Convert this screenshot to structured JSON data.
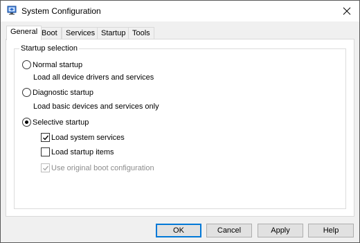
{
  "window": {
    "title": "System Configuration"
  },
  "tabs": [
    {
      "label": "General",
      "active": true
    },
    {
      "label": "Boot",
      "active": false
    },
    {
      "label": "Services",
      "active": false
    },
    {
      "label": "Startup",
      "active": false
    },
    {
      "label": "Tools",
      "active": false
    }
  ],
  "startup_selection": {
    "legend": "Startup selection",
    "normal": {
      "label": "Normal startup",
      "description": "Load all device drivers and services",
      "selected": false
    },
    "diagnostic": {
      "label": "Diagnostic startup",
      "description": "Load basic devices and services only",
      "selected": false
    },
    "selective": {
      "label": "Selective startup",
      "selected": true
    },
    "options": {
      "load_system_services": {
        "label": "Load system services",
        "checked": true,
        "enabled": true
      },
      "load_startup_items": {
        "label": "Load startup items",
        "checked": false,
        "enabled": true
      },
      "use_original_boot": {
        "label": "Use original boot configuration",
        "checked": true,
        "enabled": false
      }
    }
  },
  "buttons": {
    "ok": "OK",
    "cancel": "Cancel",
    "apply": "Apply",
    "help": "Help"
  },
  "icons": {
    "app": "msconfig-icon",
    "close": "close-icon"
  },
  "colors": {
    "accent": "#0078d7",
    "window_bg": "#f0f0f0",
    "panel_bg": "#ffffff",
    "disabled_text": "#8d8d8d"
  }
}
